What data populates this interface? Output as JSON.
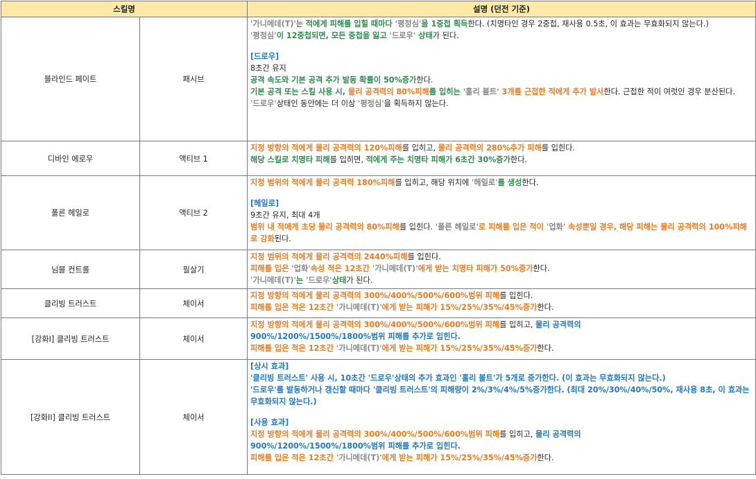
{
  "header": {
    "col_skill": "스킬명",
    "col_desc": "설명 (던전 기준)"
  },
  "colors": {
    "header_bg": "#fde9a8",
    "green": "#2f8a4d",
    "orange": "#ee7a1c",
    "blue": "#1e78c2",
    "gray": "#888888",
    "border": "#777777"
  },
  "rows": [
    {
      "name": "블라인드 페이트",
      "type": "패시브",
      "lines": [
        [
          {
            "t": "'가니메데(T)'",
            "c": "gr"
          },
          {
            "t": "는 ",
            "c": "k"
          },
          {
            "t": "적에게 피해를 입힐 때마다 ",
            "c": "g"
          },
          {
            "t": "'평정심'",
            "c": "gr"
          },
          {
            "t": "을 1중첩 획득",
            "c": "g"
          },
          {
            "t": "한다. (치명타인 경우 2중첩, 재사용 0.5초, 이 효과는 무효화되지 않는다.)",
            "c": "k"
          }
        ],
        [
          {
            "t": "'평정심'",
            "c": "gr"
          },
          {
            "t": "이 12중첩되면, 모든 중첩을 잃고 ",
            "c": "g"
          },
          {
            "t": "'드로우'",
            "c": "gr"
          },
          {
            "t": " 상태",
            "c": "g"
          },
          {
            "t": "가 된다.",
            "c": "k"
          }
        ],
        [],
        [
          {
            "t": "[드로우]",
            "c": "b"
          }
        ],
        [
          {
            "t": "8초간 유지",
            "c": "k"
          }
        ],
        [
          {
            "t": "공격 속도와 기본 공격 추가 발동 확률이 50%증가",
            "c": "g"
          },
          {
            "t": "한다.",
            "c": "k"
          }
        ],
        [
          {
            "t": "기본 공격 또는 스킬 사용 시, ",
            "c": "g"
          },
          {
            "t": "물리 공격력의 80%피해",
            "c": "o"
          },
          {
            "t": "를 입히는 ",
            "c": "g"
          },
          {
            "t": "'홀리 볼트'",
            "c": "gr"
          },
          {
            "t": " 3개를 근접한 적에게 추가 발사",
            "c": "o"
          },
          {
            "t": "한다. 근접한 적이 여럿인 경우 분산된다.",
            "c": "k"
          }
        ],
        [
          {
            "t": "'드로우'",
            "c": "gr"
          },
          {
            "t": "상태인 동안에는 더 이상 ",
            "c": "k"
          },
          {
            "t": "'평정심'",
            "c": "gr"
          },
          {
            "t": "을 획득하지 않는다.",
            "c": "k"
          }
        ]
      ]
    },
    {
      "name": "디바인 에로우",
      "type": "액티브 1",
      "lines": [
        [
          {
            "t": "지정 방향의 적에게 물리 공격력의 120%피해",
            "c": "o"
          },
          {
            "t": "를 입히고, ",
            "c": "k"
          },
          {
            "t": "물리 공격력의 280%추가 피해",
            "c": "o"
          },
          {
            "t": "를 입힌다.",
            "c": "k"
          }
        ],
        [
          {
            "t": "해당 스킬로 치명타 피해",
            "c": "g"
          },
          {
            "t": "를 입히면, ",
            "c": "k"
          },
          {
            "t": "적에게 주는 치명타 피해가 6초간 30%증가",
            "c": "g"
          },
          {
            "t": "한다.",
            "c": "k"
          }
        ]
      ]
    },
    {
      "name": "폴른 헤일로",
      "type": "액티브 2",
      "lines": [
        [
          {
            "t": "지정 범위의 적에게 물리 공격력 180%피해",
            "c": "o"
          },
          {
            "t": "를 입히고, 해당 위치에 ",
            "c": "k"
          },
          {
            "t": "'헤일로'",
            "c": "gr"
          },
          {
            "t": "를 생성",
            "c": "g"
          },
          {
            "t": "한다.",
            "c": "k"
          }
        ],
        [],
        [
          {
            "t": "[헤일로]",
            "c": "b"
          }
        ],
        [
          {
            "t": "9초간 유지, 최대 4개",
            "c": "k"
          }
        ],
        [
          {
            "t": "범위 내 적에게 초당 물리 공격력의 80%피해",
            "c": "o"
          },
          {
            "t": "를 입힌다. ",
            "c": "k"
          },
          {
            "t": "'폴른 헤일로'",
            "c": "gr"
          },
          {
            "t": "로 피해를 입은 적이 ",
            "c": "o"
          },
          {
            "t": "'업화'",
            "c": "gr"
          },
          {
            "t": " 속성뿐일 경우, 해당 피해는 물리 공격력의 100%피해로 강화",
            "c": "o"
          },
          {
            "t": "된다.",
            "c": "k"
          }
        ]
      ]
    },
    {
      "name": "님블 컨트롤",
      "type": "필살기",
      "lines": [
        [
          {
            "t": "지정 범위의 적에게 물리 공격력의 2440%피해",
            "c": "o"
          },
          {
            "t": "를 입힌다.",
            "c": "k"
          }
        ],
        [
          {
            "t": "피해를 입은 ",
            "c": "o"
          },
          {
            "t": "'업화'",
            "c": "gr"
          },
          {
            "t": "속성 적은 12초간 ",
            "c": "o"
          },
          {
            "t": "'가니메데(T)'",
            "c": "gr"
          },
          {
            "t": "에게 받는 치명타 피해가 50%증가",
            "c": "o"
          },
          {
            "t": "한다.",
            "c": "k"
          }
        ],
        [
          {
            "t": "'가니메데(T)'",
            "c": "gr"
          },
          {
            "t": "는 ",
            "c": "g"
          },
          {
            "t": "'드로우'",
            "c": "gr"
          },
          {
            "t": "상태",
            "c": "g"
          },
          {
            "t": "가 된다.",
            "c": "k"
          }
        ]
      ]
    },
    {
      "name": "클리빙 트러스트",
      "type": "체이서",
      "lines": [
        [
          {
            "t": "지정 방향의 적에게 물리 공격력의 300%/400%/500%/600%범위 피해",
            "c": "o"
          },
          {
            "t": "를 입힌다.",
            "c": "k"
          }
        ],
        [
          {
            "t": "피해를 입은 적은 12초간 ",
            "c": "o"
          },
          {
            "t": "'가니메데(T)'",
            "c": "gr"
          },
          {
            "t": "에게 받는 피해가 15%/25%/35%/45%증가",
            "c": "o"
          },
          {
            "t": "한다.",
            "c": "k"
          }
        ]
      ]
    },
    {
      "name": "[강화I] 클리빙 트러스트",
      "type": "체이서",
      "lines": [
        [
          {
            "t": "지정 방향의 적에게 물리 공격력의 300%/400%/500%/600%범위 피해",
            "c": "o"
          },
          {
            "t": "를 입히고, ",
            "c": "k"
          },
          {
            "t": "물리 공격력의",
            "c": "b"
          }
        ],
        [
          {
            "t": "900%/1200%/1500%/1800%범위 피해를 추가로 입힌다.",
            "c": "b"
          }
        ],
        [
          {
            "t": "피해를 입은 적은 12초간 ",
            "c": "o"
          },
          {
            "t": "'가니메데(T)'",
            "c": "gr"
          },
          {
            "t": "에게 받는 피해가 15%/25%/35%/45%증가",
            "c": "o"
          },
          {
            "t": "한다.",
            "c": "k"
          }
        ]
      ]
    },
    {
      "name": "[강화II] 클리빙 트러스트",
      "type": "체이서",
      "lines": [
        [
          {
            "t": "[상시 효과]",
            "c": "b"
          }
        ],
        [
          {
            "t": "'클리빙 트러스트' 사용 시, 10초간 '드로우'상태의 추가 효과인 '홀리 볼트'가 5개로 증가한다. (이 효과는 무효화되지 않는다.)",
            "c": "b"
          }
        ],
        [
          {
            "t": "'드로우'를 발동하거나 갱신할 때마다 '클리빙 트러스트'의 피해량이 2%/3%/4%/5%증가한다. (최대 20%/30%/40%/50%, 재사용 8초, 이 효과는 무효화되지 않는다.)",
            "c": "b"
          }
        ],
        [],
        [
          {
            "t": "[사용 효과]",
            "c": "b"
          }
        ],
        [
          {
            "t": "지정 방향의 적에게 물리 공격력의 300%/400%/500%/600%범위 피해",
            "c": "o"
          },
          {
            "t": "를 입히고, ",
            "c": "k"
          },
          {
            "t": "물리 공격력의",
            "c": "b"
          }
        ],
        [
          {
            "t": "900%/1200%/1500%/1800%범위 피해를 추가로 입힌다.",
            "c": "b"
          }
        ],
        [
          {
            "t": "피해를 입은 적은 12초간 ",
            "c": "o"
          },
          {
            "t": "'가니메데(T)'",
            "c": "gr"
          },
          {
            "t": "에게 받는 피해가 15%/25%/35%/45%증가",
            "c": "o"
          },
          {
            "t": "한다.",
            "c": "k"
          }
        ]
      ]
    }
  ]
}
